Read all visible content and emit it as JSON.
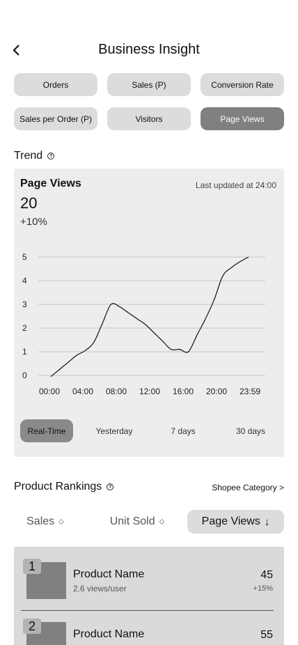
{
  "header": {
    "title": "Business Insight",
    "back_icon": "chevron-left-icon"
  },
  "metrics": [
    {
      "label": "Orders",
      "active": false
    },
    {
      "label": "Sales (P)",
      "active": false
    },
    {
      "label": "Conversion Rate",
      "active": false
    },
    {
      "label": "Sales per Order (P)",
      "active": false
    },
    {
      "label": "Visitors",
      "active": false
    },
    {
      "label": "Page Views",
      "active": true
    }
  ],
  "trend": {
    "label": "Trend",
    "help_icon": "help-icon",
    "card_title": "Page Views",
    "updated": "Last updated at 24:00",
    "value": "20",
    "change": "+10%",
    "range_tabs": [
      {
        "label": "Real-Time",
        "active": true
      },
      {
        "label": "Yesterday",
        "active": false
      },
      {
        "label": "7 days",
        "active": false
      },
      {
        "label": "30 days",
        "active": false
      }
    ]
  },
  "chart_data": {
    "type": "line",
    "x": [
      "00:00",
      "01:00",
      "02:00",
      "03:00",
      "04:00",
      "05:00",
      "06:00",
      "07:00",
      "08:00",
      "09:00",
      "10:00",
      "11:00",
      "12:00",
      "13:00",
      "14:00",
      "15:00",
      "16:00",
      "17:00",
      "18:00",
      "19:00",
      "20:00",
      "21:00",
      "22:00",
      "23:59"
    ],
    "x_tick_labels": [
      "00:00",
      "04:00",
      "08:00",
      "12:00",
      "16:00",
      "20:00",
      "23:59"
    ],
    "values": [
      -0.05,
      0.25,
      0.55,
      0.85,
      1.05,
      1.4,
      2.2,
      3.0,
      2.9,
      2.65,
      2.4,
      2.15,
      1.8,
      1.45,
      1.1,
      1.1,
      1.0,
      1.7,
      2.4,
      3.2,
      4.2,
      4.55,
      4.8,
      5.0
    ],
    "y_ticks": [
      0,
      1,
      2,
      3,
      4,
      5
    ],
    "ylim": [
      0,
      5
    ],
    "grid": true,
    "title": "",
    "xlabel": "",
    "ylabel": "",
    "line_color": "#111111",
    "grid_color": "#c8c8c8"
  },
  "rankings": {
    "title": "Product Rankings",
    "help_icon": "help-icon",
    "category_link": "Shopee Category >",
    "sort_tabs": [
      {
        "label": "Sales",
        "icon": "⬦",
        "icon_name": "sort-icon",
        "active": false
      },
      {
        "label": "Unit Sold",
        "icon": "⬦",
        "icon_name": "sort-icon",
        "active": false
      },
      {
        "label": "Page Views",
        "icon": "↓",
        "icon_name": "arrow-down-icon",
        "active": true
      }
    ],
    "items": [
      {
        "rank": "1",
        "name": "Product Name",
        "meta": "2.6 views/user",
        "value": "45",
        "change": "+15%"
      },
      {
        "rank": "2",
        "name": "Product Name",
        "meta": "",
        "value": "55",
        "change": ""
      }
    ]
  },
  "colors": {
    "active_fill": "#808080",
    "inactive_fill": "#dcdcdc",
    "card_bg": "#ededed",
    "panel_bg": "#dadada"
  }
}
